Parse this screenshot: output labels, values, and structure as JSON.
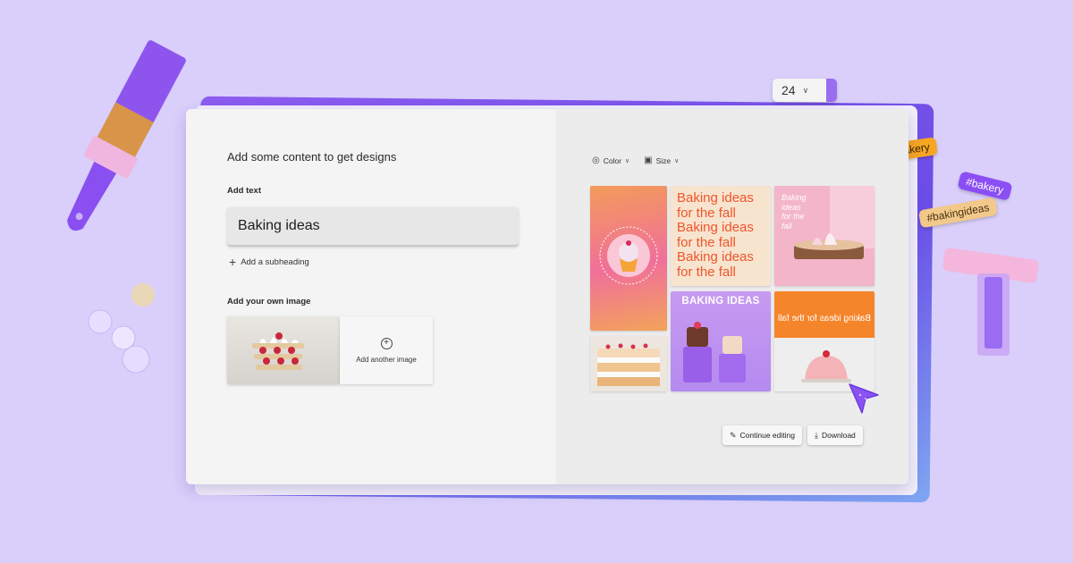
{
  "tags": {
    "best_bakery": "#thebestbakery",
    "bakery": "#bakery",
    "baking_ideas": "#bakingideas"
  },
  "size_chip": {
    "value": "24"
  },
  "editor": {
    "heading": "Add some content to get designs",
    "add_text_label": "Add text",
    "text_value": "Baking ideas",
    "add_subheading": "Add a subheading",
    "add_image_label": "Add your own image",
    "add_another_image": "Add another image"
  },
  "designs": {
    "filters": {
      "color": "Color",
      "size": "Size"
    },
    "tile2_lines": [
      "Baking ideas",
      "for the fall",
      "Baking ideas",
      "for the fall",
      "Baking ideas",
      "for the fall"
    ],
    "tile3_lines": [
      "Baking",
      "ideas",
      "for the",
      "fall"
    ],
    "tile5_title": "BAKING IDEAS",
    "tile6_text": "Baking ideas for the fall",
    "continue_editing": "Continue editing",
    "download": "Download"
  },
  "colors": {
    "background": "#d9cffa",
    "accent_purple": "#8b4ef5",
    "accent_orange": "#f5852a"
  },
  "icons": [
    "paintbrush-icon",
    "plus-icon",
    "circle-plus-icon",
    "color-palette-icon",
    "resize-icon",
    "pencil-icon",
    "download-icon",
    "cursor-pointer-icon"
  ]
}
